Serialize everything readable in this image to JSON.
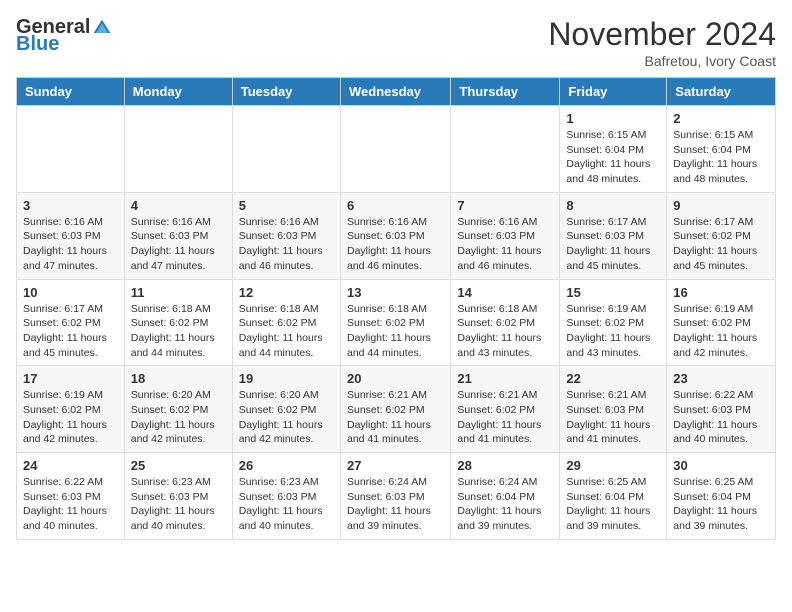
{
  "logo": {
    "general": "General",
    "blue": "Blue"
  },
  "title": "November 2024",
  "location": "Bafretou, Ivory Coast",
  "headers": [
    "Sunday",
    "Monday",
    "Tuesday",
    "Wednesday",
    "Thursday",
    "Friday",
    "Saturday"
  ],
  "weeks": [
    [
      {
        "day": "",
        "info": ""
      },
      {
        "day": "",
        "info": ""
      },
      {
        "day": "",
        "info": ""
      },
      {
        "day": "",
        "info": ""
      },
      {
        "day": "",
        "info": ""
      },
      {
        "day": "1",
        "info": "Sunrise: 6:15 AM\nSunset: 6:04 PM\nDaylight: 11 hours\nand 48 minutes."
      },
      {
        "day": "2",
        "info": "Sunrise: 6:15 AM\nSunset: 6:04 PM\nDaylight: 11 hours\nand 48 minutes."
      }
    ],
    [
      {
        "day": "3",
        "info": "Sunrise: 6:16 AM\nSunset: 6:03 PM\nDaylight: 11 hours\nand 47 minutes."
      },
      {
        "day": "4",
        "info": "Sunrise: 6:16 AM\nSunset: 6:03 PM\nDaylight: 11 hours\nand 47 minutes."
      },
      {
        "day": "5",
        "info": "Sunrise: 6:16 AM\nSunset: 6:03 PM\nDaylight: 11 hours\nand 46 minutes."
      },
      {
        "day": "6",
        "info": "Sunrise: 6:16 AM\nSunset: 6:03 PM\nDaylight: 11 hours\nand 46 minutes."
      },
      {
        "day": "7",
        "info": "Sunrise: 6:16 AM\nSunset: 6:03 PM\nDaylight: 11 hours\nand 46 minutes."
      },
      {
        "day": "8",
        "info": "Sunrise: 6:17 AM\nSunset: 6:03 PM\nDaylight: 11 hours\nand 45 minutes."
      },
      {
        "day": "9",
        "info": "Sunrise: 6:17 AM\nSunset: 6:02 PM\nDaylight: 11 hours\nand 45 minutes."
      }
    ],
    [
      {
        "day": "10",
        "info": "Sunrise: 6:17 AM\nSunset: 6:02 PM\nDaylight: 11 hours\nand 45 minutes."
      },
      {
        "day": "11",
        "info": "Sunrise: 6:18 AM\nSunset: 6:02 PM\nDaylight: 11 hours\nand 44 minutes."
      },
      {
        "day": "12",
        "info": "Sunrise: 6:18 AM\nSunset: 6:02 PM\nDaylight: 11 hours\nand 44 minutes."
      },
      {
        "day": "13",
        "info": "Sunrise: 6:18 AM\nSunset: 6:02 PM\nDaylight: 11 hours\nand 44 minutes."
      },
      {
        "day": "14",
        "info": "Sunrise: 6:18 AM\nSunset: 6:02 PM\nDaylight: 11 hours\nand 43 minutes."
      },
      {
        "day": "15",
        "info": "Sunrise: 6:19 AM\nSunset: 6:02 PM\nDaylight: 11 hours\nand 43 minutes."
      },
      {
        "day": "16",
        "info": "Sunrise: 6:19 AM\nSunset: 6:02 PM\nDaylight: 11 hours\nand 42 minutes."
      }
    ],
    [
      {
        "day": "17",
        "info": "Sunrise: 6:19 AM\nSunset: 6:02 PM\nDaylight: 11 hours\nand 42 minutes."
      },
      {
        "day": "18",
        "info": "Sunrise: 6:20 AM\nSunset: 6:02 PM\nDaylight: 11 hours\nand 42 minutes."
      },
      {
        "day": "19",
        "info": "Sunrise: 6:20 AM\nSunset: 6:02 PM\nDaylight: 11 hours\nand 42 minutes."
      },
      {
        "day": "20",
        "info": "Sunrise: 6:21 AM\nSunset: 6:02 PM\nDaylight: 11 hours\nand 41 minutes."
      },
      {
        "day": "21",
        "info": "Sunrise: 6:21 AM\nSunset: 6:02 PM\nDaylight: 11 hours\nand 41 minutes."
      },
      {
        "day": "22",
        "info": "Sunrise: 6:21 AM\nSunset: 6:03 PM\nDaylight: 11 hours\nand 41 minutes."
      },
      {
        "day": "23",
        "info": "Sunrise: 6:22 AM\nSunset: 6:03 PM\nDaylight: 11 hours\nand 40 minutes."
      }
    ],
    [
      {
        "day": "24",
        "info": "Sunrise: 6:22 AM\nSunset: 6:03 PM\nDaylight: 11 hours\nand 40 minutes."
      },
      {
        "day": "25",
        "info": "Sunrise: 6:23 AM\nSunset: 6:03 PM\nDaylight: 11 hours\nand 40 minutes."
      },
      {
        "day": "26",
        "info": "Sunrise: 6:23 AM\nSunset: 6:03 PM\nDaylight: 11 hours\nand 40 minutes."
      },
      {
        "day": "27",
        "info": "Sunrise: 6:24 AM\nSunset: 6:03 PM\nDaylight: 11 hours\nand 39 minutes."
      },
      {
        "day": "28",
        "info": "Sunrise: 6:24 AM\nSunset: 6:04 PM\nDaylight: 11 hours\nand 39 minutes."
      },
      {
        "day": "29",
        "info": "Sunrise: 6:25 AM\nSunset: 6:04 PM\nDaylight: 11 hours\nand 39 minutes."
      },
      {
        "day": "30",
        "info": "Sunrise: 6:25 AM\nSunset: 6:04 PM\nDaylight: 11 hours\nand 39 minutes."
      }
    ]
  ]
}
